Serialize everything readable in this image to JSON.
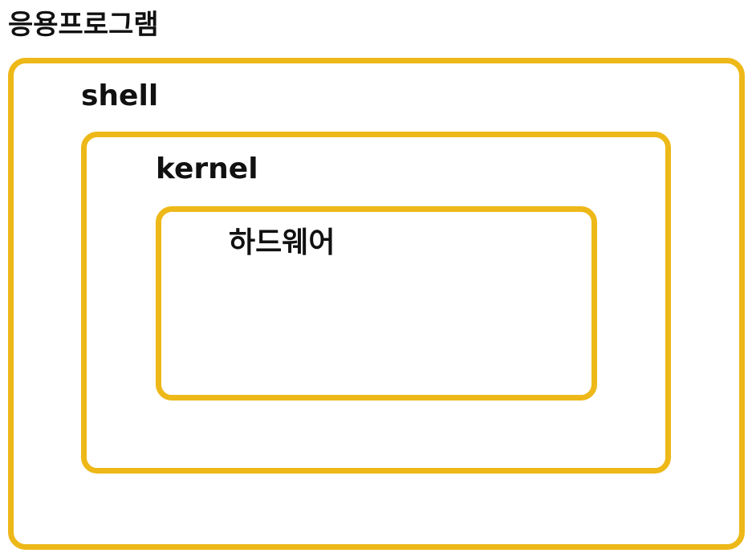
{
  "diagram": {
    "layers": [
      {
        "label": "응용프로그램"
      },
      {
        "label": "shell"
      },
      {
        "label": "kernel"
      },
      {
        "label": "하드웨어"
      }
    ],
    "colors": {
      "border": "#EDB818",
      "text": "#111111",
      "background": "#FFFFFF"
    }
  }
}
